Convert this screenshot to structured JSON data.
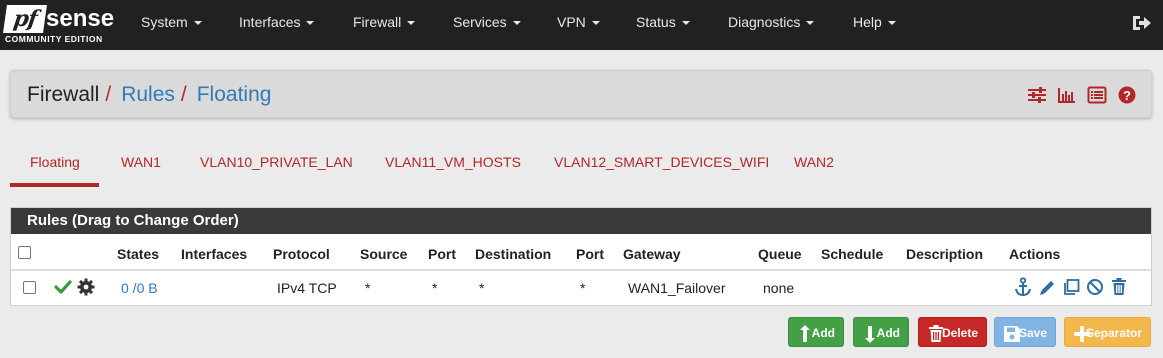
{
  "logo": {
    "pf": "pf",
    "sense": "sense",
    "edition": "COMMUNITY EDITION"
  },
  "nav": [
    "System",
    "Interfaces",
    "Firewall",
    "Services",
    "VPN",
    "Status",
    "Diagnostics",
    "Help"
  ],
  "breadcrumb": {
    "root": "Firewall",
    "sep": "/",
    "level1": "Rules",
    "level2": "Floating"
  },
  "header_icons": [
    "sliders-icon",
    "bar-chart-icon",
    "list-icon",
    "help-icon"
  ],
  "tabs": [
    "Floating",
    "WAN1",
    "VLAN10_PRIVATE_LAN",
    "VLAN11_VM_HOSTS",
    "VLAN12_SMART_DEVICES_WIFI",
    "WAN2"
  ],
  "active_tab": "Floating",
  "rules": {
    "title": "Rules (Drag to Change Order)",
    "columns": [
      "States",
      "Interfaces",
      "Protocol",
      "Source",
      "Port",
      "Destination",
      "Port",
      "Gateway",
      "Queue",
      "Schedule",
      "Description",
      "Actions"
    ],
    "rows": [
      {
        "states": "0 /0 B",
        "interfaces": "",
        "protocol": "IPv4 TCP",
        "source": "*",
        "source_port": "*",
        "destination": "*",
        "destination_port": "*",
        "gateway": "WAN1_Failover",
        "queue": "none",
        "schedule": "",
        "description": ""
      }
    ]
  },
  "buttons": {
    "add_top": "Add",
    "add_bottom": "Add",
    "delete": "Delete",
    "save": "Save",
    "separator": "Separator"
  },
  "colors": {
    "accent_red": "#b22727",
    "link_blue": "#337ab7",
    "navbar": "#212121",
    "green": "#43a047",
    "blue_icon": "#2e6da4"
  }
}
